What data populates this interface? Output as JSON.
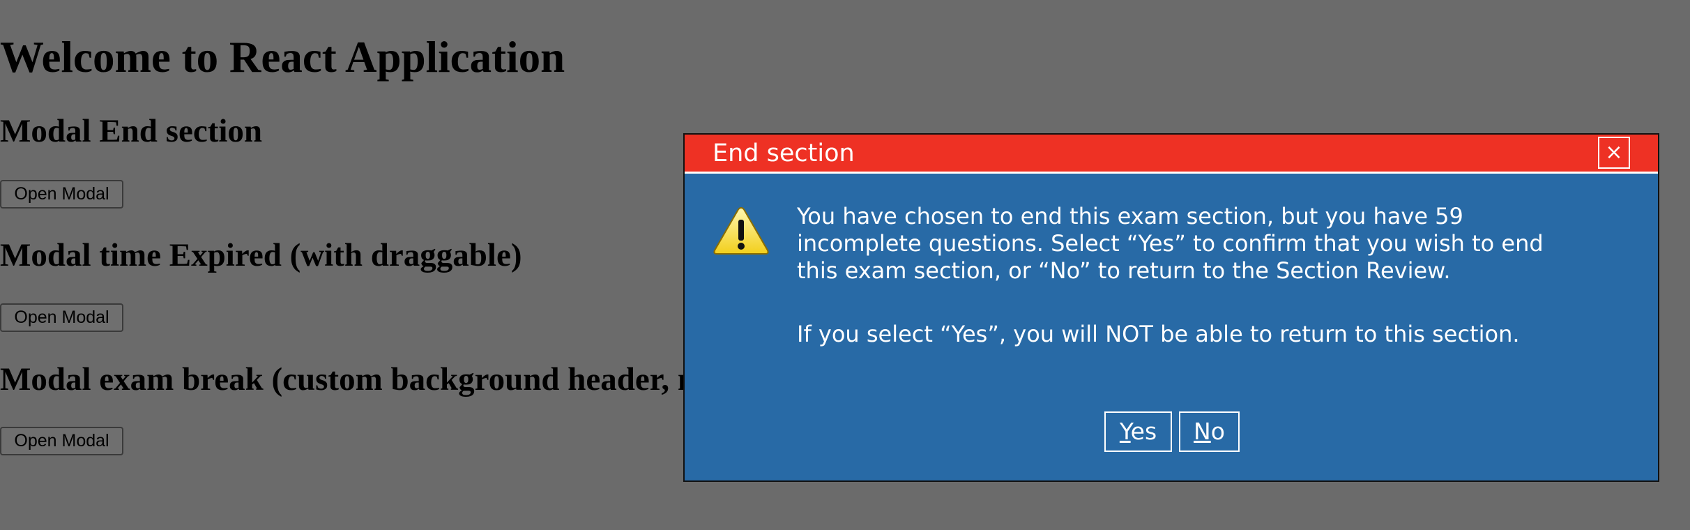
{
  "page": {
    "title": "Welcome to React Application",
    "sections": [
      {
        "heading": "Modal End section",
        "button_label": "Open Modal"
      },
      {
        "heading": "Modal time Expired (with draggable)",
        "button_label": "Open Modal"
      },
      {
        "heading": "Modal exam break (custom background header, no title and controllers)",
        "button_label": "Open Modal"
      }
    ]
  },
  "modal": {
    "title": "End section",
    "close_label": "×",
    "icon": "warning-icon",
    "message_line1": "You have chosen to end this exam section, but you have 59",
    "message_line2": "incomplete questions. Select “Yes” to confirm that you wish to end",
    "message_line3": "this exam section, or “No” to return to the Section Review.",
    "warning": "If you select “Yes”, you will NOT be able to return to this section.",
    "yes_mnemonic": "Y",
    "yes_rest": "es",
    "no_mnemonic": "N",
    "no_rest": "o",
    "colors": {
      "header": "#ee3124",
      "body": "#286aa6",
      "overlay": "#6b6b6b"
    }
  }
}
